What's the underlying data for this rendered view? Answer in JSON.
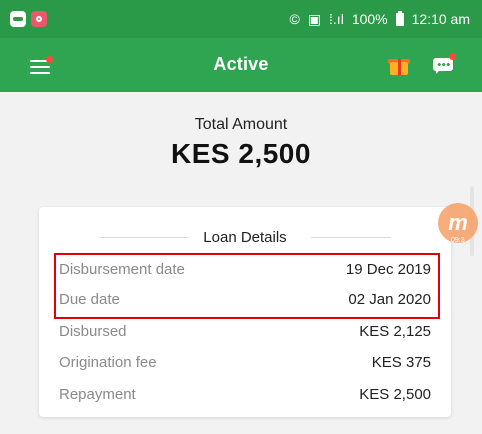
{
  "status_bar": {
    "battery": "100%",
    "time": "12:10 am",
    "icons": [
      "cast-icon",
      "screen-mirror-icon",
      "signal-icon",
      "battery-icon"
    ]
  },
  "app_bar": {
    "title": "Active",
    "menu_icon": "hamburger-menu-icon",
    "gift_icon": "gift-icon",
    "chat_icon": "chat-icon"
  },
  "summary": {
    "total_label": "Total Amount",
    "total_value": "KES  2,500"
  },
  "loan_details": {
    "title": "Loan Details",
    "rows": [
      {
        "label": "Disbursement date",
        "value": "19 Dec 2019"
      },
      {
        "label": "Due date",
        "value": "02 Jan 2020"
      },
      {
        "label": "Disbursed",
        "value": "KES  2,125"
      },
      {
        "label": "Origination fee",
        "value": "KES  375"
      },
      {
        "label": "Repayment",
        "value": "KES  2,500"
      }
    ]
  },
  "floating_badge": {
    "letter": "m",
    "time": "09:3"
  },
  "colors": {
    "status_bar": "#2a9a49",
    "app_bar": "#2fa552",
    "highlight_border": "#e0000f",
    "notification_dot": "#ff4a3a"
  }
}
